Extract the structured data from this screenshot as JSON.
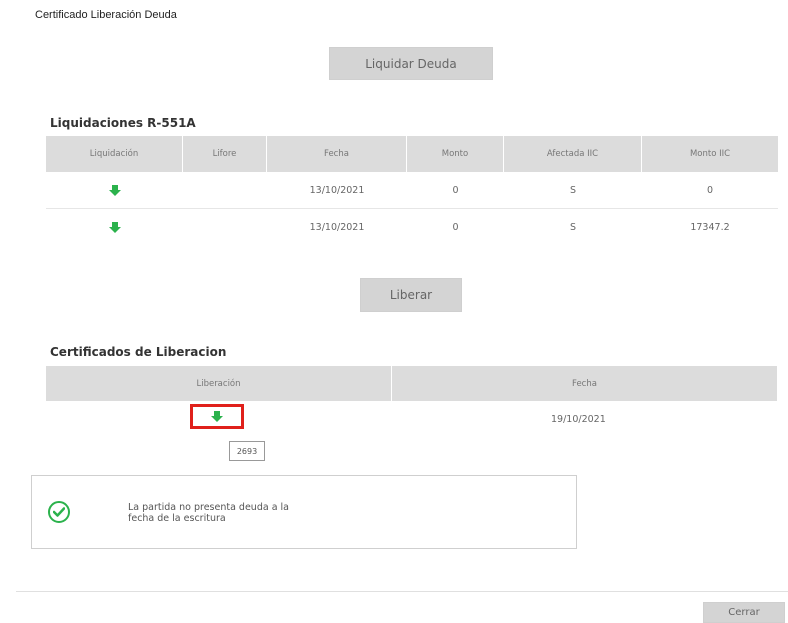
{
  "header": {
    "title": "Certificado Liberación Deuda"
  },
  "buttons": {
    "liquidar": "Liquidar Deuda",
    "liberar": "Liberar",
    "cerrar": "Cerrar"
  },
  "liquidaciones": {
    "title": "Liquidaciones R-551A",
    "columns": [
      "Liquidación",
      "Lifore",
      "Fecha",
      "Monto",
      "Afectada IIC",
      "Monto IIC"
    ],
    "rows": [
      {
        "lifore": "",
        "fecha": "13/10/2021",
        "monto": "0",
        "afectada": "S",
        "monto_iic": "0"
      },
      {
        "lifore": "",
        "fecha": "13/10/2021",
        "monto": "0",
        "afectada": "S",
        "monto_iic": "17347.2"
      }
    ]
  },
  "certificados": {
    "title": "Certificados de Liberacion",
    "columns": [
      "Liberación",
      "Fecha"
    ],
    "rows": [
      {
        "fecha": "19/10/2021",
        "tooltip": "2693"
      }
    ]
  },
  "message": {
    "line1": "La partida no presenta deuda a la",
    "line2": "fecha de la escritura"
  },
  "colors": {
    "accent_green": "#2bb24c",
    "highlight_red": "#e0201b",
    "header_gray": "#dcdcdc",
    "button_gray": "#d4d4d4"
  }
}
